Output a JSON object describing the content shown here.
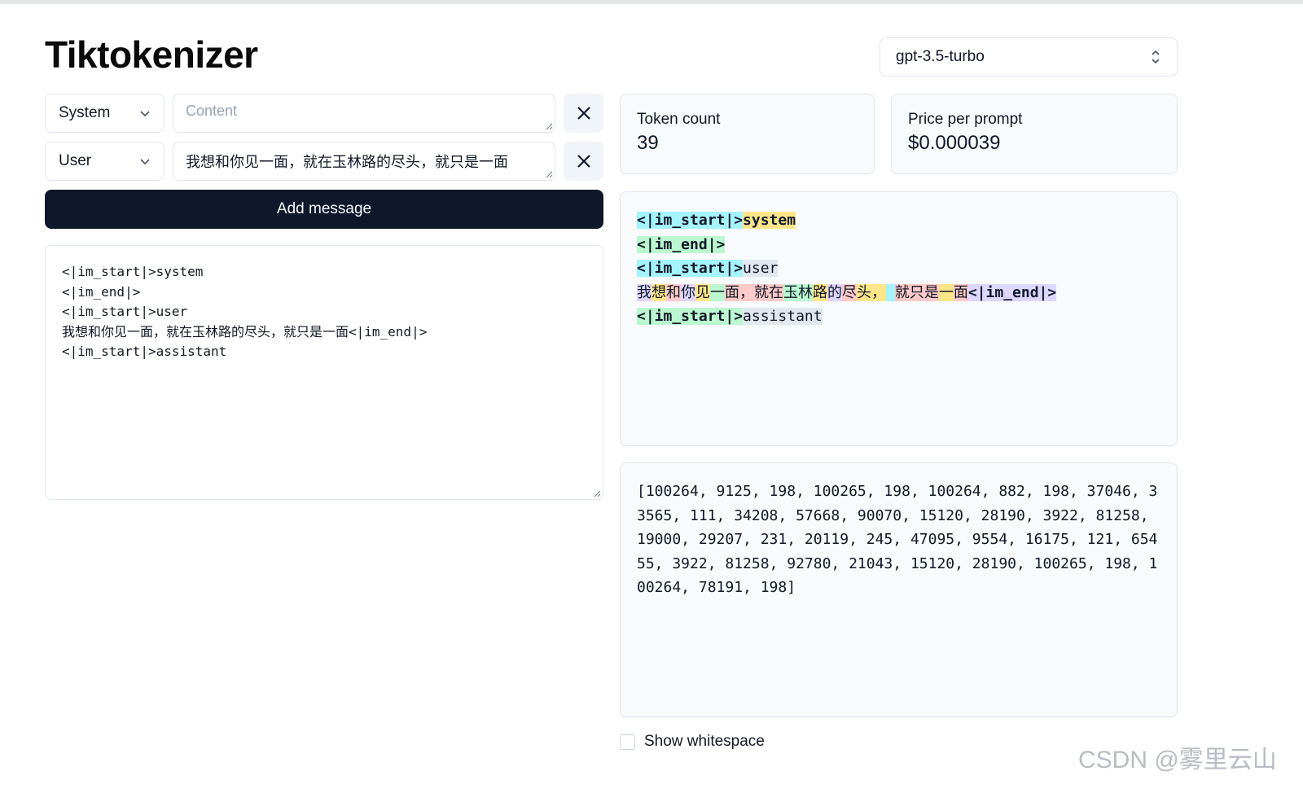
{
  "app": {
    "title": "Tiktokenizer"
  },
  "model_select": {
    "value": "gpt-3.5-turbo"
  },
  "messages": [
    {
      "role": "System",
      "content": "",
      "placeholder": "Content"
    },
    {
      "role": "User",
      "content": "我想和你见一面，就在玉林路的尽头，就只是一面",
      "placeholder": "Content"
    }
  ],
  "add_message_label": "Add message",
  "prompt_lines": [
    "<|im_start|>system",
    "<|im_end|>",
    "<|im_start|>user",
    "我想和你见一面，就在玉林路的尽头，就只是一面<|im_end|>",
    "<|im_start|>assistant"
  ],
  "stats": {
    "token_count_label": "Token count",
    "token_count": "39",
    "price_label": "Price per prompt",
    "price": "$0.000039"
  },
  "token_colors": [
    "#a5f3fc",
    "#fde68a",
    "#bbf7d0",
    "#fecaca",
    "#ddd6fe",
    "#e2e8f0"
  ],
  "token_lines": [
    [
      {
        "t": "<|im_start|>",
        "c": 0,
        "bold": true
      },
      {
        "t": "system",
        "c": 1,
        "bold": true
      }
    ],
    [
      {
        "t": "<|im_end|>",
        "c": 2,
        "bold": true
      }
    ],
    [
      {
        "t": "<|im_start|>",
        "c": 0,
        "bold": true
      },
      {
        "t": "user",
        "c": 5,
        "bold": false
      }
    ],
    [
      {
        "t": "我",
        "c": 4
      },
      {
        "t": "想",
        "c": 1
      },
      {
        "t": "和",
        "c": 3
      },
      {
        "t": "你",
        "c": 4
      },
      {
        "t": "见",
        "c": 1
      },
      {
        "t": "一",
        "c": 2
      },
      {
        "t": "面，",
        "c": 3
      },
      {
        "t": "就",
        "c": 3
      },
      {
        "t": "在",
        "c": 3
      },
      {
        "t": "玉",
        "c": 2
      },
      {
        "t": "林",
        "c": 2
      },
      {
        "t": "路",
        "c": 1
      },
      {
        "t": "的",
        "c": 4
      },
      {
        "t": "尽",
        "c": 3
      },
      {
        "t": "头，",
        "c": 1
      },
      {
        "t": " ",
        "c": 0
      },
      {
        "t": "就",
        "c": 3
      },
      {
        "t": "只",
        "c": 3
      },
      {
        "t": "是",
        "c": 3
      },
      {
        "t": "一",
        "c": 1
      },
      {
        "t": "面",
        "c": 3
      },
      {
        "t": "<|im_end|>",
        "c": 4,
        "bold": true
      }
    ],
    [
      {
        "t": "<|im_start|>",
        "c": 2,
        "bold": true
      },
      {
        "t": "assistant",
        "c": 5,
        "bold": false
      }
    ]
  ],
  "token_ids": "[100264, 9125, 198, 100265, 198, 100264, 882, 198, 37046, 33565, 111, 34208, 57668, 90070, 15120, 28190, 3922, 81258, 19000, 29207, 231, 20119, 245, 47095, 9554, 16175, 121, 65455, 3922, 81258, 92780, 21043, 15120, 28190, 100265, 198, 100264, 78191, 198]",
  "show_whitespace": {
    "label": "Show whitespace",
    "checked": false
  },
  "watermark": "CSDN @雾里云山"
}
